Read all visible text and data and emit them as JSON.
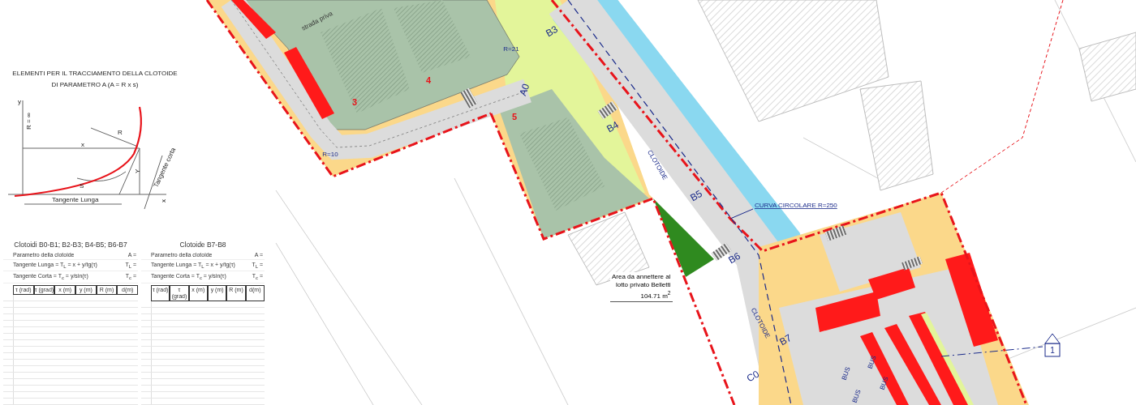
{
  "title_lines": [
    "ELEMENTI PER IL TRACCIAMENTO DELLA CLOTOIDE",
    "DI PARAMETRO A (A = R x s)"
  ],
  "diagram_labels": [
    "y",
    "R = ∞",
    "x",
    "R",
    "S",
    "Y",
    "x",
    "Tangente Lunga",
    "Tangente corta"
  ],
  "tables": [
    {
      "title": "Clotoidi B0-B1; B2-B3; B4-B5; B6-B7",
      "params": [
        {
          "label": "Parametro della clotoide",
          "symbol": "A ="
        },
        {
          "label": "Tangente Lunga = T$_{L}$ = x + y/tg(τ)",
          "symbol": "T$_{L}$ ="
        },
        {
          "label": "Tangente Corta = T$_{c}$ = y/sin(τ)",
          "symbol": "T$_{c}$ ="
        }
      ],
      "columns": [
        "τ (rad)",
        "τ (grad)",
        "x (m)",
        "y (m)",
        "R (m)",
        "d(m)"
      ]
    },
    {
      "title": "Clotoide B7-B8",
      "params": [
        {
          "label": "Parametro della clotoide",
          "symbol": "A ="
        },
        {
          "label": "Tangente Lunga = T$_{L}$ = x + y/tg(τ)",
          "symbol": "T$_{L}$ ="
        },
        {
          "label": "Tangente Corta = T$_{c}$ = y/sin(τ)",
          "symbol": "T$_{c}$ ="
        }
      ],
      "columns": [
        "τ (rad)",
        "τ (grad)",
        "x (m)",
        "y (m)",
        "R (m)",
        "d(m)"
      ]
    }
  ],
  "map_labels": [
    {
      "kind": "lot",
      "text": "3"
    },
    {
      "kind": "lot",
      "text": "4"
    },
    {
      "kind": "lot",
      "text": "5"
    },
    {
      "kind": "radius",
      "text": "R=21"
    },
    {
      "kind": "radius",
      "text": "R=10"
    },
    {
      "kind": "station",
      "text": "A0"
    },
    {
      "kind": "station",
      "text": "B3"
    },
    {
      "kind": "station",
      "text": "B4"
    },
    {
      "kind": "station",
      "text": "B5"
    },
    {
      "kind": "station",
      "text": "B6"
    },
    {
      "kind": "station",
      "text": "B7"
    },
    {
      "kind": "station",
      "text": "C0"
    },
    {
      "kind": "curve",
      "text": "CLOTOIDE"
    },
    {
      "kind": "curve",
      "text": "CLOTOIDE"
    },
    {
      "kind": "street",
      "text": "strada priva"
    },
    {
      "kind": "note",
      "text": "CURVA CIRCOLARE R=250"
    },
    {
      "kind": "bus",
      "text": "BUS"
    },
    {
      "kind": "bus",
      "text": "BUS"
    },
    {
      "kind": "bus",
      "text": "BUS"
    },
    {
      "kind": "bus",
      "text": "BUS"
    },
    {
      "kind": "marker",
      "text": "1"
    }
  ],
  "callout": {
    "lines": [
      "Area da annettere al",
      "lotto privato Belletti",
      "104.71 m$^{2}$"
    ]
  }
}
